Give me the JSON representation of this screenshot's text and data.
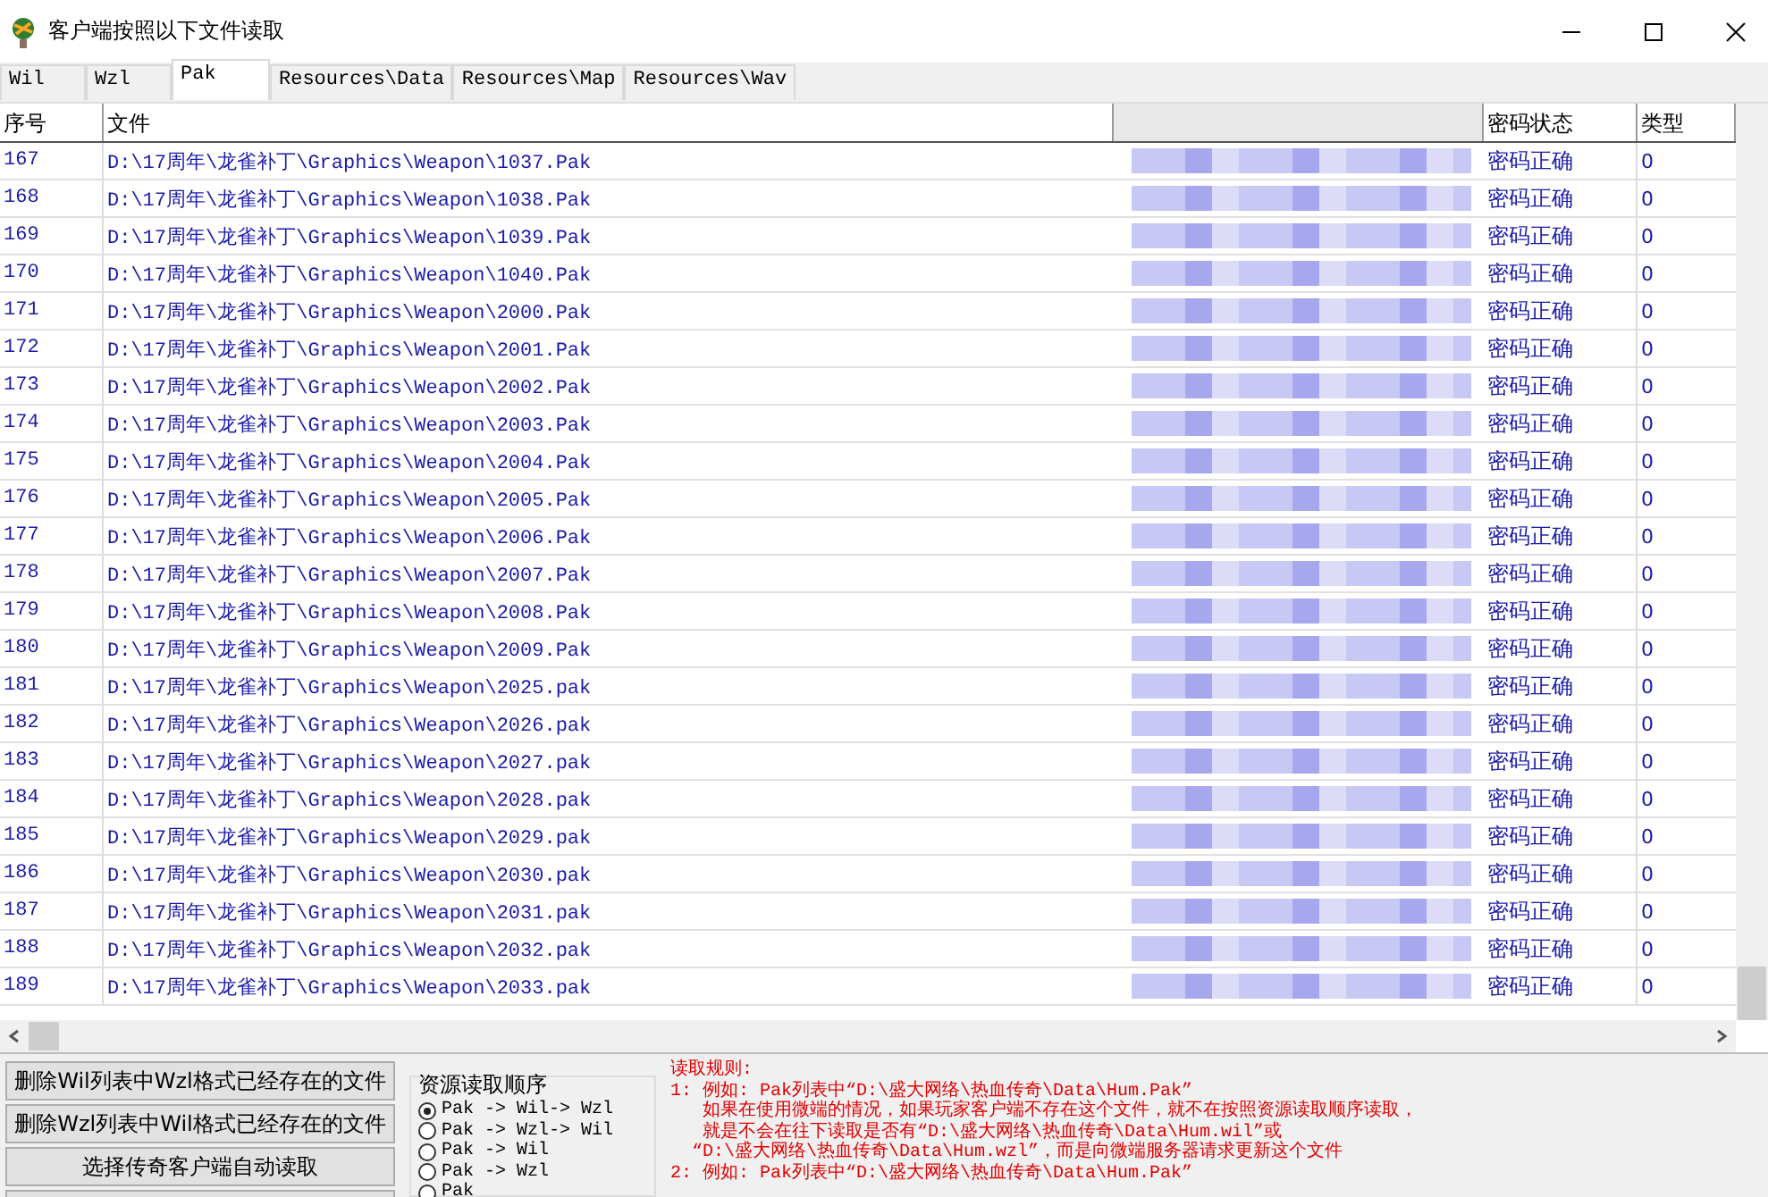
{
  "window": {
    "title": "客户端按照以下文件读取"
  },
  "tabs": [
    {
      "label": "Wil",
      "selected": false
    },
    {
      "label": "Wzl",
      "selected": false
    },
    {
      "label": "Pak",
      "selected": true
    },
    {
      "label": "Resources\\Data",
      "selected": false
    },
    {
      "label": "Resources\\Map",
      "selected": false
    },
    {
      "label": "Resources\\Wav",
      "selected": false
    }
  ],
  "table": {
    "columns": [
      "序号",
      "文件",
      "密码状态",
      "类型"
    ],
    "rows": [
      {
        "index": "167",
        "file": "D:\\17周年\\龙雀补丁\\Graphics\\Weapon\\1037.Pak",
        "status": "密码正确",
        "type": "0"
      },
      {
        "index": "168",
        "file": "D:\\17周年\\龙雀补丁\\Graphics\\Weapon\\1038.Pak",
        "status": "密码正确",
        "type": "0"
      },
      {
        "index": "169",
        "file": "D:\\17周年\\龙雀补丁\\Graphics\\Weapon\\1039.Pak",
        "status": "密码正确",
        "type": "0"
      },
      {
        "index": "170",
        "file": "D:\\17周年\\龙雀补丁\\Graphics\\Weapon\\1040.Pak",
        "status": "密码正确",
        "type": "0"
      },
      {
        "index": "171",
        "file": "D:\\17周年\\龙雀补丁\\Graphics\\Weapon\\2000.Pak",
        "status": "密码正确",
        "type": "0"
      },
      {
        "index": "172",
        "file": "D:\\17周年\\龙雀补丁\\Graphics\\Weapon\\2001.Pak",
        "status": "密码正确",
        "type": "0"
      },
      {
        "index": "173",
        "file": "D:\\17周年\\龙雀补丁\\Graphics\\Weapon\\2002.Pak",
        "status": "密码正确",
        "type": "0"
      },
      {
        "index": "174",
        "file": "D:\\17周年\\龙雀补丁\\Graphics\\Weapon\\2003.Pak",
        "status": "密码正确",
        "type": "0"
      },
      {
        "index": "175",
        "file": "D:\\17周年\\龙雀补丁\\Graphics\\Weapon\\2004.Pak",
        "status": "密码正确",
        "type": "0"
      },
      {
        "index": "176",
        "file": "D:\\17周年\\龙雀补丁\\Graphics\\Weapon\\2005.Pak",
        "status": "密码正确",
        "type": "0"
      },
      {
        "index": "177",
        "file": "D:\\17周年\\龙雀补丁\\Graphics\\Weapon\\2006.Pak",
        "status": "密码正确",
        "type": "0"
      },
      {
        "index": "178",
        "file": "D:\\17周年\\龙雀补丁\\Graphics\\Weapon\\2007.Pak",
        "status": "密码正确",
        "type": "0"
      },
      {
        "index": "179",
        "file": "D:\\17周年\\龙雀补丁\\Graphics\\Weapon\\2008.Pak",
        "status": "密码正确",
        "type": "0"
      },
      {
        "index": "180",
        "file": "D:\\17周年\\龙雀补丁\\Graphics\\Weapon\\2009.Pak",
        "status": "密码正确",
        "type": "0"
      },
      {
        "index": "181",
        "file": "D:\\17周年\\龙雀补丁\\Graphics\\Weapon\\2025.pak",
        "status": "密码正确",
        "type": "0"
      },
      {
        "index": "182",
        "file": "D:\\17周年\\龙雀补丁\\Graphics\\Weapon\\2026.pak",
        "status": "密码正确",
        "type": "0"
      },
      {
        "index": "183",
        "file": "D:\\17周年\\龙雀补丁\\Graphics\\Weapon\\2027.pak",
        "status": "密码正确",
        "type": "0"
      },
      {
        "index": "184",
        "file": "D:\\17周年\\龙雀补丁\\Graphics\\Weapon\\2028.pak",
        "status": "密码正确",
        "type": "0"
      },
      {
        "index": "185",
        "file": "D:\\17周年\\龙雀补丁\\Graphics\\Weapon\\2029.pak",
        "status": "密码正确",
        "type": "0"
      },
      {
        "index": "186",
        "file": "D:\\17周年\\龙雀补丁\\Graphics\\Weapon\\2030.pak",
        "status": "密码正确",
        "type": "0"
      },
      {
        "index": "187",
        "file": "D:\\17周年\\龙雀补丁\\Graphics\\Weapon\\2031.pak",
        "status": "密码正确",
        "type": "0"
      },
      {
        "index": "188",
        "file": "D:\\17周年\\龙雀补丁\\Graphics\\Weapon\\2032.pak",
        "status": "密码正确",
        "type": "0"
      },
      {
        "index": "189",
        "file": "D:\\17周年\\龙雀补丁\\Graphics\\Weapon\\2033.pak",
        "status": "密码正确",
        "type": "0"
      }
    ]
  },
  "buttons": [
    "删除Wil列表中Wzl格式已经存在的文件",
    "删除Wzl列表中Wil格式已经存在的文件",
    "选择传奇客户端自动读取"
  ],
  "read_order": {
    "title": "资源读取顺序",
    "options": [
      {
        "label": "Pak -> Wil-> Wzl",
        "selected": true
      },
      {
        "label": "Pak -> Wzl-> Wil",
        "selected": false
      },
      {
        "label": "Pak -> Wil",
        "selected": false
      },
      {
        "label": "Pak -> Wzl",
        "selected": false
      },
      {
        "label": "Pak",
        "selected": false
      }
    ]
  },
  "rules": [
    "读取规则:",
    "1: 例如: Pak列表中“D:\\盛大网络\\热血传奇\\Data\\Hum.Pak”",
    "   如果在使用微端的情况，如果玩家客户端不存在这个文件，就不在按照资源读取顺序读取，",
    "   就是不会在往下读取是否有“D:\\盛大网络\\热血传奇\\Data\\Hum.wil”或",
    "  “D:\\盛大网络\\热血传奇\\Data\\Hum.wzl”，而是向微端服务器请求更新这个文件",
    "2: 例如: Pak列表中“D:\\盛大网络\\热血传奇\\Data\\Hum.Pak”"
  ]
}
